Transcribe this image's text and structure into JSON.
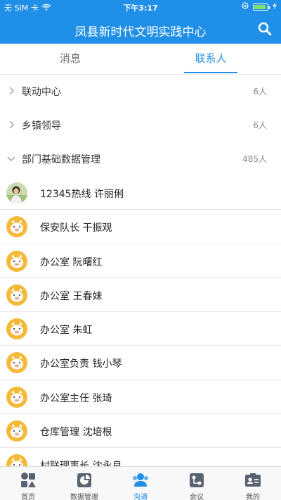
{
  "status_bar": {
    "carrier": "无 SIM 卡",
    "time": "下午3:17",
    "battery_level": 0.9
  },
  "header": {
    "title": "凤县新时代文明实践中心",
    "search_icon": "search-icon"
  },
  "tabs": [
    {
      "label": "消息",
      "active": false
    },
    {
      "label": "联系人",
      "active": true
    }
  ],
  "groups": [
    {
      "label": "联动中心",
      "count": "6人",
      "expanded": false
    },
    {
      "label": "乡镇领导",
      "count": "6人",
      "expanded": false
    },
    {
      "label": "部门基础数据管理",
      "count": "485人",
      "expanded": true
    }
  ],
  "contacts": [
    {
      "name": "12345热线  许丽俐",
      "avatar": "photo"
    },
    {
      "name": "保安队长 干振观",
      "avatar": "default"
    },
    {
      "name": "办公室 阮曙红",
      "avatar": "default"
    },
    {
      "name": "办公室 王春妹",
      "avatar": "default"
    },
    {
      "name": "办公室 朱虹",
      "avatar": "default"
    },
    {
      "name": "办公室负责 钱小琴",
      "avatar": "default"
    },
    {
      "name": "办公室主任 张琦",
      "avatar": "default"
    },
    {
      "name": "仓库管理 沈培根",
      "avatar": "default"
    },
    {
      "name": "村联理事长 沈永良",
      "avatar": "default"
    }
  ],
  "tabbar": [
    {
      "label": "首页",
      "icon": "home-icon",
      "active": false
    },
    {
      "label": "数据管理",
      "icon": "data-management-icon",
      "active": false
    },
    {
      "label": "沟通",
      "icon": "communication-icon",
      "active": true
    },
    {
      "label": "会议",
      "icon": "meeting-icon",
      "active": false
    },
    {
      "label": "我的",
      "icon": "profile-icon",
      "active": false
    }
  ],
  "colors": {
    "primary": "#1f8fe8",
    "avatar_default": "#f5b93a"
  }
}
